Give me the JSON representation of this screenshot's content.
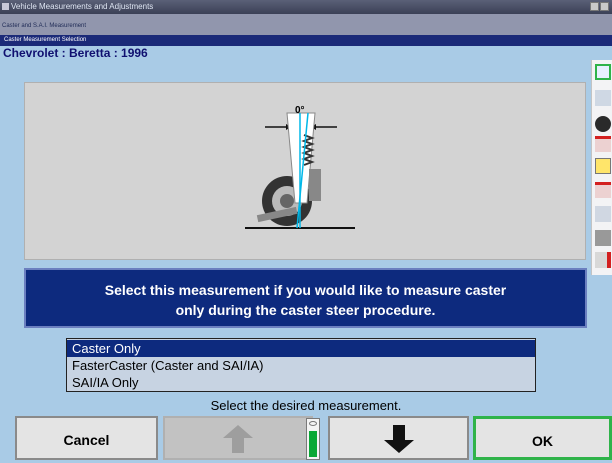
{
  "window": {
    "title": "Vehicle Measurements and Adjustments"
  },
  "subheader": {
    "title": "Caster and S.A.I. Measurement"
  },
  "section": {
    "title": "Caster Measurement Selection"
  },
  "vehicle": {
    "label": "Chevrolet : Beretta : 1996"
  },
  "illustration": {
    "angle_label": "0°"
  },
  "description": {
    "line1": "Select this measurement if you would like to measure caster",
    "line2": "only during the caster steer procedure."
  },
  "options": [
    {
      "label": "Caster Only",
      "selected": true
    },
    {
      "label": "FasterCaster (Caster and SAI/IA)",
      "selected": false
    },
    {
      "label": "SAI/IA Only",
      "selected": false
    }
  ],
  "prompt": "Select the desired measurement.",
  "buttons": {
    "cancel": "Cancel",
    "ok": "OK"
  },
  "colors": {
    "highlight": "#0d2a7e",
    "background": "#a9cbe6",
    "ok_border": "#2fb34a"
  }
}
